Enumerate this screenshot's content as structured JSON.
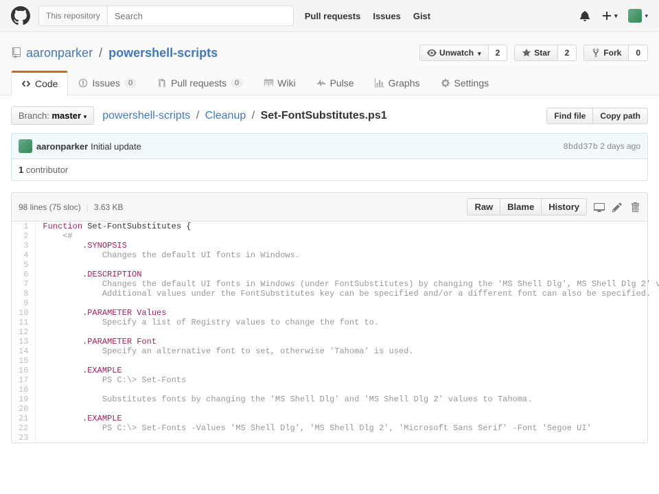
{
  "header": {
    "search_scope": "This repository",
    "search_placeholder": "Search",
    "nav": {
      "pulls": "Pull requests",
      "issues": "Issues",
      "gist": "Gist"
    }
  },
  "repo": {
    "owner": "aaronparker",
    "name": "powershell-scripts",
    "actions": {
      "unwatch": "Unwatch",
      "unwatch_count": "2",
      "star": "Star",
      "star_count": "2",
      "fork": "Fork",
      "fork_count": "0"
    }
  },
  "reponav": {
    "code": "Code",
    "issues": "Issues",
    "issues_count": "0",
    "pulls": "Pull requests",
    "pulls_count": "0",
    "wiki": "Wiki",
    "pulse": "Pulse",
    "graphs": "Graphs",
    "settings": "Settings"
  },
  "file_nav": {
    "branch_label": "Branch:",
    "branch_name": "master",
    "crumb_root": "powershell-scripts",
    "crumb_dir": "Cleanup",
    "crumb_file": "Set-FontSubstitutes.ps1",
    "find_file": "Find file",
    "copy_path": "Copy path"
  },
  "commit": {
    "author": "aaronparker",
    "message": "Initial update",
    "sha": "8bdd37b",
    "age": "2 days ago"
  },
  "contributors": {
    "count": "1",
    "label": " contributor"
  },
  "file_info": {
    "lines": "98 lines (75 sloc)",
    "size": "3.63 KB",
    "raw": "Raw",
    "blame": "Blame",
    "history": "History"
  },
  "code": [
    {
      "n": 1,
      "t": "k",
      "v": "Function Set-FontSubstitutes {"
    },
    {
      "n": 2,
      "t": "c",
      "v": "    <#"
    },
    {
      "n": 3,
      "t": "c2",
      "v": "        .SYNOPSIS"
    },
    {
      "n": 4,
      "t": "c",
      "v": "            Changes the default UI fonts in Windows."
    },
    {
      "n": 5,
      "t": "c",
      "v": ""
    },
    {
      "n": 6,
      "t": "c2",
      "v": "        .DESCRIPTION"
    },
    {
      "n": 7,
      "t": "c",
      "v": "            Changes the default UI fonts in Windows (under FontSubstitutes) by changing the 'MS Shell Dlg', MS Shell Dlg 2' values to Tahom"
    },
    {
      "n": 8,
      "t": "c",
      "v": "            Additional values under the FontSubstitutes key can be specified and/or a different font can also be specified."
    },
    {
      "n": 9,
      "t": "c",
      "v": ""
    },
    {
      "n": 10,
      "t": "c2",
      "v": "        .PARAMETER Values"
    },
    {
      "n": 11,
      "t": "c",
      "v": "            Specify a list of Registry values to change the font to."
    },
    {
      "n": 12,
      "t": "c",
      "v": ""
    },
    {
      "n": 13,
      "t": "c2",
      "v": "        .PARAMETER Font"
    },
    {
      "n": 14,
      "t": "c",
      "v": "            Specify an alternative font to set, otherwise 'Tahoma' is used."
    },
    {
      "n": 15,
      "t": "c",
      "v": ""
    },
    {
      "n": 16,
      "t": "c2",
      "v": "        .EXAMPLE"
    },
    {
      "n": 17,
      "t": "c",
      "v": "            PS C:\\> Set-Fonts"
    },
    {
      "n": 18,
      "t": "c",
      "v": ""
    },
    {
      "n": 19,
      "t": "c",
      "v": "            Substitutes fonts by changing the 'MS Shell Dlg' and 'MS Shell Dlg 2' values to Tahoma."
    },
    {
      "n": 20,
      "t": "c",
      "v": ""
    },
    {
      "n": 21,
      "t": "c2",
      "v": "        .EXAMPLE"
    },
    {
      "n": 22,
      "t": "c",
      "v": "            PS C:\\> Set-Fonts -Values 'MS Shell Dlg', 'MS Shell Dlg 2', 'Microsoft Sans Serif' -Font 'Segoe UI'"
    },
    {
      "n": 23,
      "t": "c",
      "v": ""
    }
  ]
}
